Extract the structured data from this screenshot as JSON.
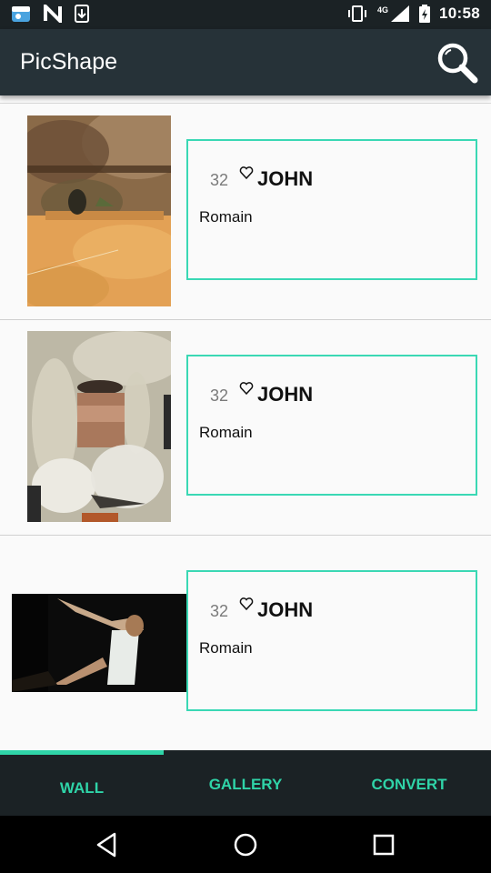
{
  "status_bar": {
    "time": "10:58",
    "network": "4G",
    "icons": [
      "weather-icon",
      "n-icon",
      "download-icon",
      "vibrate-icon",
      "signal-icon",
      "battery-icon"
    ]
  },
  "app_bar": {
    "title": "PicShape",
    "search_icon": "search-icon"
  },
  "feed": {
    "items": [
      {
        "likes": "32",
        "author": "JOHN",
        "title": "Romain",
        "heart_icon": "heart-outline-icon"
      },
      {
        "likes": "32",
        "author": "JOHN",
        "title": "Romain",
        "heart_icon": "heart-outline-icon"
      },
      {
        "likes": "32",
        "author": "JOHN",
        "title": "Romain",
        "heart_icon": "heart-outline-icon"
      }
    ]
  },
  "tabs": [
    {
      "label": "WALL",
      "active": true
    },
    {
      "label": "GALLERY",
      "active": false
    },
    {
      "label": "CONVERT",
      "active": false
    }
  ],
  "colors": {
    "accent": "#2fd4a8",
    "app_bar": "#263238",
    "status_bar": "#1b2225",
    "card_border": "#3ad8b4"
  },
  "nav_bar": {
    "icons": [
      "back-icon",
      "home-icon",
      "recents-icon"
    ]
  }
}
